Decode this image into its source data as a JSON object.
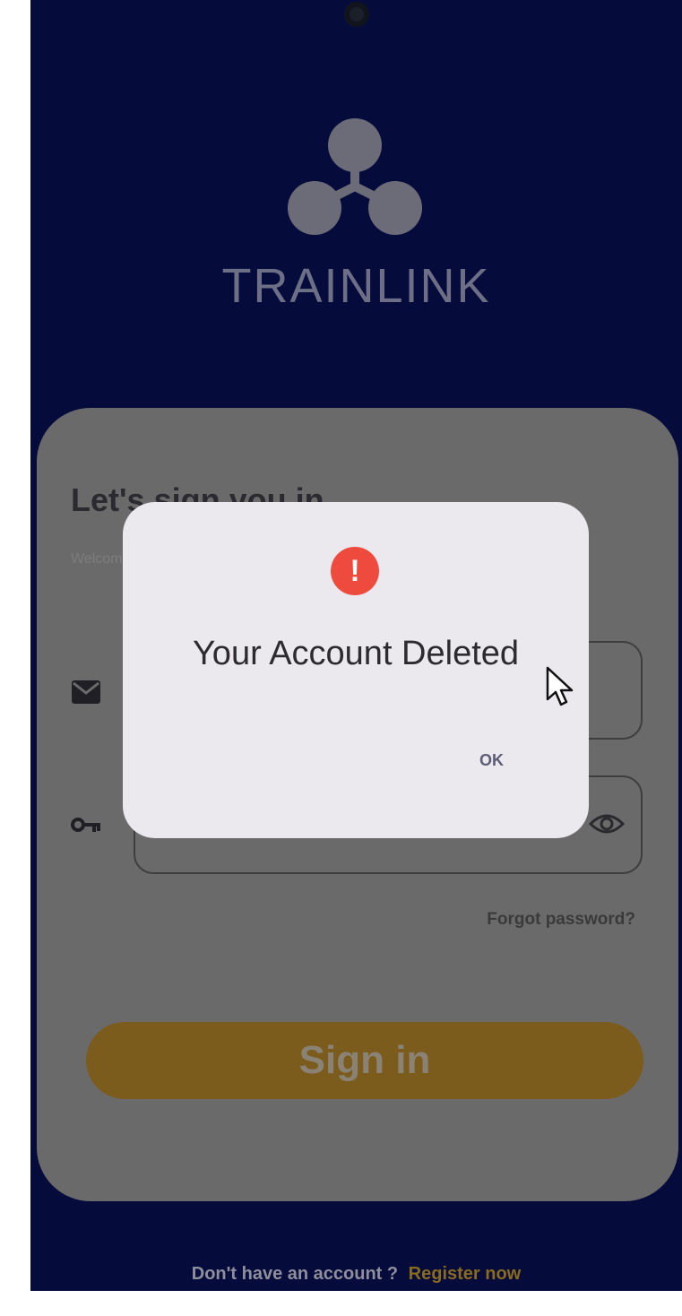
{
  "brand": {
    "name": "TRAINLINK",
    "logo_icon": "trefoil-logo-icon"
  },
  "login": {
    "title": "Let's sign you in.",
    "subtitle": "Welcome back",
    "email_icon": "envelope-icon",
    "password_icon": "key-icon",
    "password_toggle_icon": "eye-icon",
    "forgot_password": "Forgot password?",
    "sign_in": "Sign in",
    "footer_prompt": "Don't have an account ?",
    "footer_link": "Register now"
  },
  "dialog": {
    "icon": "alert-icon",
    "icon_symbol": "!",
    "message": "Your Account Deleted",
    "ok_label": "OK"
  },
  "colors": {
    "background": "#050b3b",
    "accent": "#e0a12a",
    "alert": "#ee4b3e"
  }
}
